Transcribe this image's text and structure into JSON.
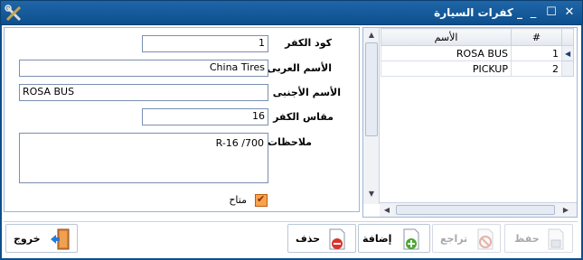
{
  "window": {
    "title": "_ كفرات السيارة",
    "minimize": "_",
    "maximize": "☐",
    "close": "✕"
  },
  "form": {
    "tire_code_label": "كود الكفر",
    "tire_code_value": "1",
    "arabic_name_label": "الأسم العربى",
    "arabic_name_value": "China Tires",
    "foreign_name_label": "الأسم الأجنبى",
    "foreign_name_value": "ROSA BUS",
    "size_label": "مقاس الكفر",
    "size_value": "16",
    "notes_label": "ملاحظات",
    "notes_value": "R-16 /700",
    "available_label": "متاح",
    "available_checked": true
  },
  "grid": {
    "columns": [
      "الأسم",
      "#"
    ],
    "rows": [
      {
        "name": "ROSA BUS",
        "num": "1"
      },
      {
        "name": "PICKUP",
        "num": "2"
      }
    ]
  },
  "toolbar": {
    "exit_label": "خروج",
    "delete_label": "حذف",
    "add_label": "إضافة",
    "undo_label": "تراجع",
    "save_label": "حفظ"
  },
  "colors": {
    "titlebar": "#1f66a8",
    "checkbox": "#f7a24c"
  }
}
